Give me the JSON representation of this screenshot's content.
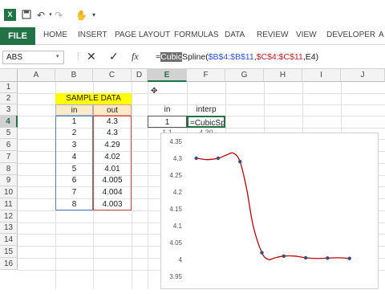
{
  "title_bar": {
    "app_icon": "excel-icon",
    "quick_access": [
      "save-icon",
      "undo-icon",
      "redo-icon",
      "customize-icon",
      "touch-mode-icon",
      "dropdown-icon"
    ]
  },
  "ribbon": {
    "file_label": "FILE",
    "tabs": [
      "HOME",
      "INSERT",
      "PAGE LAYOUT",
      "FORMULAS",
      "DATA",
      "REVIEW",
      "VIEW",
      "DEVELOPER",
      "A"
    ]
  },
  "formula_bar": {
    "name_box": "ABS",
    "fx": "fx",
    "formula_prefix": "=",
    "formula_selected": "Cubic",
    "formula_fn_rest": "Spline(",
    "formula_arg1": "$B$4:$B$11",
    "formula_comma1": ",",
    "formula_arg2": "$C$4:$C$11",
    "formula_comma2": ",",
    "formula_arg3": "E4",
    "formula_close": ")"
  },
  "grid": {
    "columns": [
      "A",
      "B",
      "C",
      "D",
      "E",
      "F",
      "G",
      "H",
      "I",
      "J"
    ],
    "rows": [
      "1",
      "2",
      "3",
      "4",
      "5",
      "6",
      "7",
      "8",
      "9",
      "10",
      "11",
      "12",
      "13",
      "14",
      "15",
      "16"
    ],
    "active_column": "E",
    "active_row": "4"
  },
  "sample_data": {
    "title": "SAMPLE DATA",
    "header_in": "in",
    "header_out": "out",
    "in_values": [
      "1",
      "2",
      "3",
      "4",
      "5",
      "6",
      "7",
      "8"
    ],
    "out_values": [
      "4.3",
      "4.3",
      "4.29",
      "4.02",
      "4.01",
      "4.005",
      "4.004",
      "4.003"
    ]
  },
  "interp": {
    "header_in": "in",
    "header_interp": "interp",
    "e4": "1",
    "f4": "=CubicSpli",
    "e5": "1.1",
    "f5": "4.30"
  },
  "colors": {
    "accent": "#217346",
    "sample_title_bg": "#ffff00",
    "header_bg": "#fdebc8",
    "curve": "#c00000",
    "marker": "#3a4f7a"
  },
  "chart_data": {
    "type": "scatter",
    "title": "",
    "xlabel": "",
    "ylabel": "",
    "ylim": [
      3.95,
      4.35
    ],
    "yticks": [
      "4.35",
      "4.3",
      "4.25",
      "4.2",
      "4.15",
      "4.1",
      "4.05",
      "4",
      "3.95"
    ],
    "xlim": [
      0.5,
      9.0
    ],
    "series": [
      {
        "type": "markers",
        "x": [
          1,
          2,
          3,
          4,
          5,
          6,
          7,
          8
        ],
        "y": [
          4.3,
          4.3,
          4.29,
          4.02,
          4.01,
          4.005,
          4.004,
          4.003
        ]
      },
      {
        "type": "spline",
        "x": [
          1,
          1.5,
          2,
          2.4,
          2.7,
          3,
          3.3,
          3.6,
          4,
          4.3,
          4.6,
          5,
          5.5,
          6,
          6.5,
          7,
          7.5,
          8
        ],
        "y": [
          4.3,
          4.296,
          4.3,
          4.31,
          4.315,
          4.29,
          4.21,
          4.1,
          4.02,
          4.0,
          4.005,
          4.01,
          4.01,
          4.005,
          4.003,
          4.004,
          4.005,
          4.003
        ]
      }
    ]
  }
}
